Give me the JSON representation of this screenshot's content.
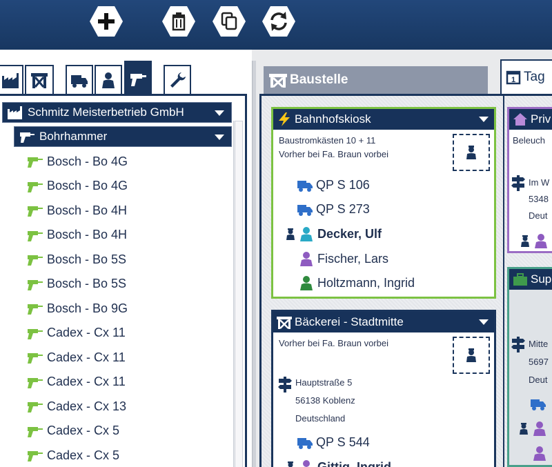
{
  "toolbar": {
    "buttons": [
      {
        "icon": "plus-icon"
      },
      {
        "icon": "trash-icon"
      },
      {
        "icon": "copy-icon"
      },
      {
        "icon": "refresh-icon"
      }
    ]
  },
  "left_tabs": [
    {
      "icon": "factory-icon"
    },
    {
      "icon": "scaffold-icon"
    },
    {
      "icon": "truck-icon"
    },
    {
      "icon": "person-icon"
    },
    {
      "icon": "drill-icon",
      "active": true
    },
    {
      "icon": "wrench-icon"
    }
  ],
  "tree": {
    "company": "Schmitz Meisterbetrieb GmbH",
    "category": "Bohrhammer",
    "items": [
      "Bosch - Bo 4G",
      "Bosch - Bo 4G",
      "Bosch - Bo 4H",
      "Bosch - Bo 4H",
      "Bosch - Bo 5S",
      "Bosch - Bo 5S",
      "Bosch - Bo 9G",
      "Cadex - Cx 11",
      "Cadex - Cx 11",
      "Cadex - Cx 11",
      "Cadex - Cx 13",
      "Cadex - Cx 5",
      "Cadex - Cx 5"
    ]
  },
  "right_tabs": {
    "baustelle": "Baustelle",
    "tag": "Tag"
  },
  "cards": {
    "bahnhofskiosk": {
      "title": "Bahnhofskiosk",
      "note1": "Baustromkästen 10 + 11",
      "note2": "Vorher bei Fa. Braun vorbei",
      "vehicles": [
        "QP S 106",
        "QP S 273"
      ],
      "people": [
        {
          "name": "Decker, Ulf",
          "color": "#29a9c6",
          "lead": true
        },
        {
          "name": "Fischer, Lars",
          "color": "#8e5bc0"
        },
        {
          "name": "Holtzmann, Ingrid",
          "color": "#2f8a3e"
        }
      ]
    },
    "baeckerei": {
      "title": "Bäckerei - Stadtmitte",
      "note1": "Vorher bei Fa. Braun vorbei",
      "address": [
        "Hauptstraße 5",
        "56138 Koblenz",
        "Deutschland"
      ],
      "vehicles": [
        "QP S 544"
      ],
      "people_partial": "Gittig, Ingrid"
    },
    "privat": {
      "title": "Priv",
      "note1": "Beleuch",
      "address": [
        "Im W",
        "5348",
        "Deut"
      ]
    },
    "sup": {
      "title": "Sup",
      "address": [
        "Mitte",
        "5697",
        "Deut"
      ]
    }
  },
  "colors": {
    "navy": "#1a355c",
    "green_border": "#7cc242",
    "purple_border": "#9b6cc4",
    "truck_blue": "#2f6fc9"
  }
}
